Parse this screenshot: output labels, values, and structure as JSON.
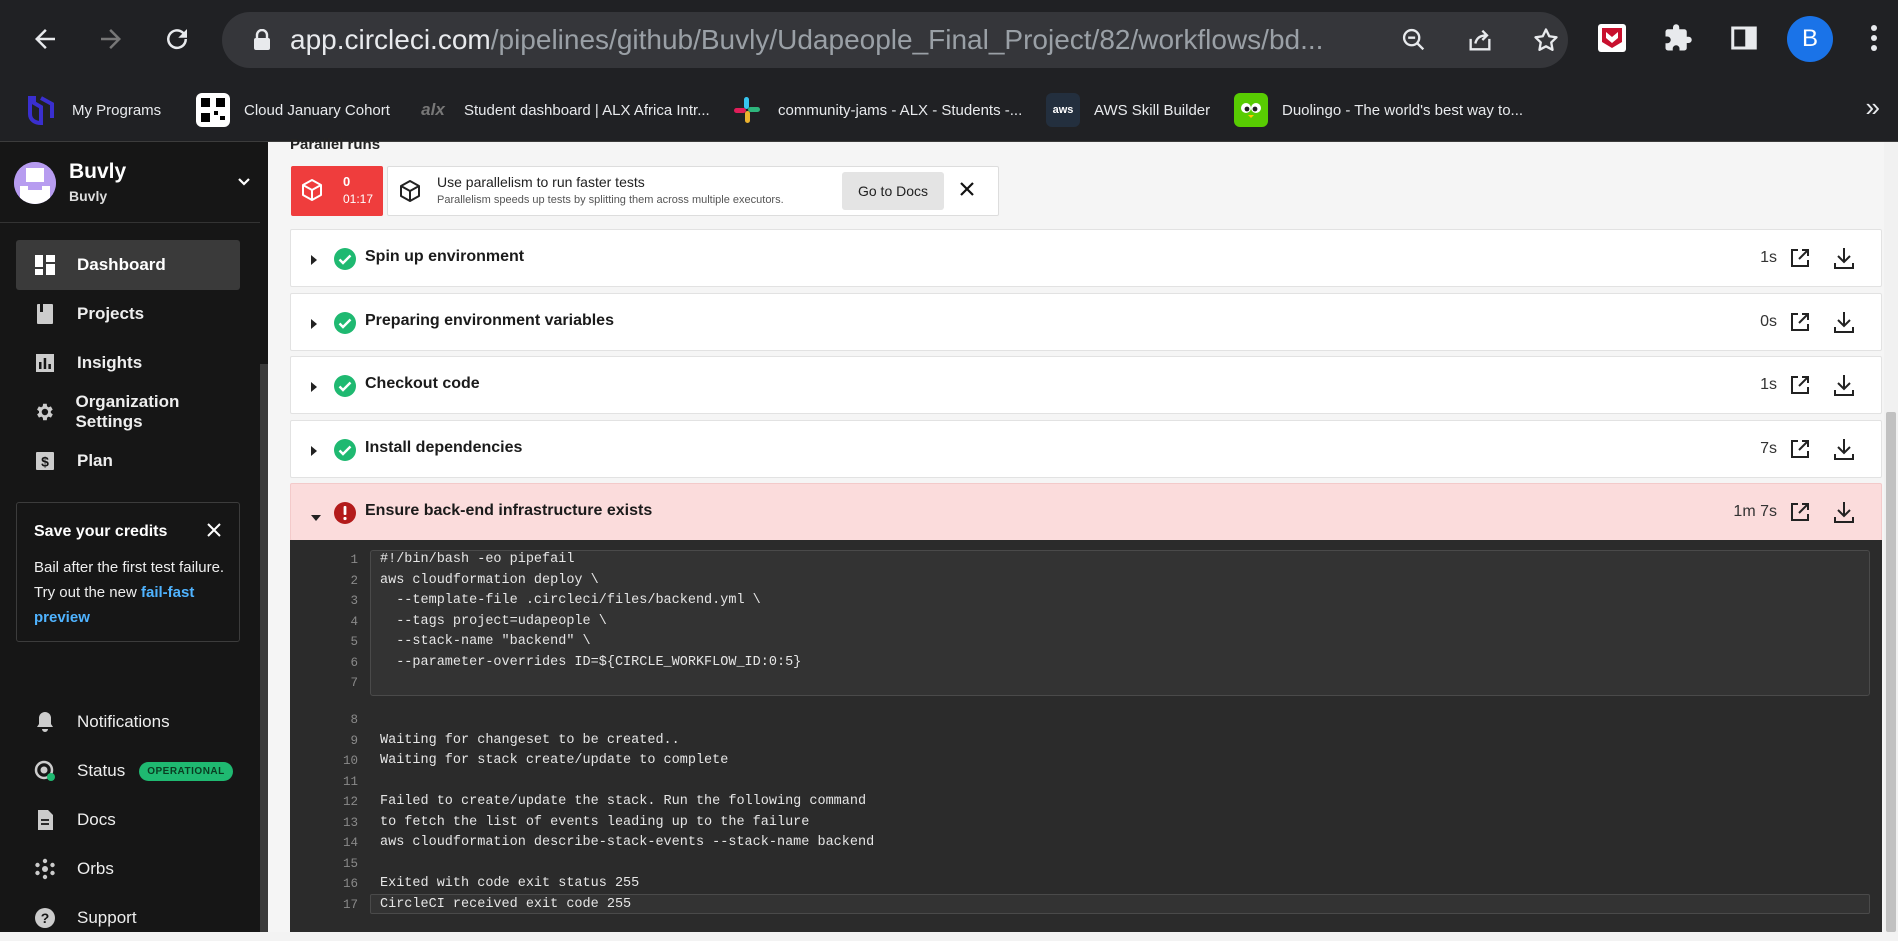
{
  "browser": {
    "url_host": "app.circleci.com",
    "url_path": "/pipelines/github/Buvly/Udapeople_Final_Project/82/workflows/bd...",
    "profile_initial": "B",
    "bookmarks": [
      {
        "label": "My Programs",
        "icon": "udacity-icon",
        "color": "#3a2fcf"
      },
      {
        "label": "Cloud January Cohort",
        "icon": "qr-icon",
        "color": "#ffffff"
      },
      {
        "label": "Student dashboard | ALX Africa Intr...",
        "icon": "alx-icon",
        "color": "#555555"
      },
      {
        "label": "community-jams - ALX - Students -...",
        "icon": "slack-icon",
        "color": "#e01e5a"
      },
      {
        "label": "AWS Skill Builder",
        "icon": "aws-icon",
        "color": "#232f3e"
      },
      {
        "label": "Duolingo - The world's best way to...",
        "icon": "duolingo-icon",
        "color": "#58cc02"
      }
    ]
  },
  "sidebar": {
    "org_name": "Buvly",
    "org_sub": "Buvly",
    "nav": [
      {
        "label": "Dashboard",
        "icon": "dashboard-icon"
      },
      {
        "label": "Projects",
        "icon": "projects-icon"
      },
      {
        "label": "Insights",
        "icon": "insights-icon"
      },
      {
        "label": "Organization Settings",
        "icon": "gear-icon"
      },
      {
        "label": "Plan",
        "icon": "dollar-icon"
      }
    ],
    "credits": {
      "title": "Save your credits",
      "body": "Bail after the first test failure. Try out the new ",
      "link": "fail-fast preview"
    },
    "bottom_nav": [
      {
        "label": "Notifications",
        "icon": "bell-icon"
      },
      {
        "label": "Status",
        "icon": "status-icon",
        "badge": "OPERATIONAL"
      },
      {
        "label": "Docs",
        "icon": "docs-icon"
      },
      {
        "label": "Orbs",
        "icon": "orbs-icon"
      },
      {
        "label": "Support",
        "icon": "support-icon"
      }
    ]
  },
  "main": {
    "section_title": "Parallel runs",
    "parallel": {
      "count": "0",
      "time": "01:17",
      "banner_title": "Use parallelism to run faster tests",
      "banner_sub": "Parallelism speeds up tests by splitting them across multiple executors.",
      "docs_button": "Go to Docs"
    },
    "steps": [
      {
        "name": "Spin up environment",
        "duration": "1s",
        "status": "success"
      },
      {
        "name": "Preparing environment variables",
        "duration": "0s",
        "status": "success"
      },
      {
        "name": "Checkout code",
        "duration": "1s",
        "status": "success"
      },
      {
        "name": "Install dependencies",
        "duration": "7s",
        "status": "success"
      },
      {
        "name": "Ensure back-end infrastructure exists",
        "duration": "1m 7s",
        "status": "failed"
      }
    ],
    "output_lines": [
      {
        "n": "1",
        "text": "#!/bin/bash -eo pipefail"
      },
      {
        "n": "2",
        "text": "aws cloudformation deploy \\"
      },
      {
        "n": "3",
        "text": "  --template-file .circleci/files/backend.yml \\"
      },
      {
        "n": "4",
        "text": "  --tags project=udapeople \\"
      },
      {
        "n": "5",
        "text": "  --stack-name \"backend\" \\"
      },
      {
        "n": "6",
        "text": "  --parameter-overrides ID=${CIRCLE_WORKFLOW_ID:0:5}"
      },
      {
        "n": "7",
        "text": ""
      },
      {
        "n": "8",
        "text": ""
      },
      {
        "n": "9",
        "text": "Waiting for changeset to be created.."
      },
      {
        "n": "10",
        "text": "Waiting for stack create/update to complete"
      },
      {
        "n": "11",
        "text": ""
      },
      {
        "n": "12",
        "text": "Failed to create/update the stack. Run the following command"
      },
      {
        "n": "13",
        "text": "to fetch the list of events leading up to the failure"
      },
      {
        "n": "14",
        "text": "aws cloudformation describe-stack-events --stack-name backend"
      },
      {
        "n": "15",
        "text": ""
      },
      {
        "n": "16",
        "text": "Exited with code exit status 255"
      },
      {
        "n": "17",
        "text": "CircleCI received exit code 255"
      }
    ]
  }
}
